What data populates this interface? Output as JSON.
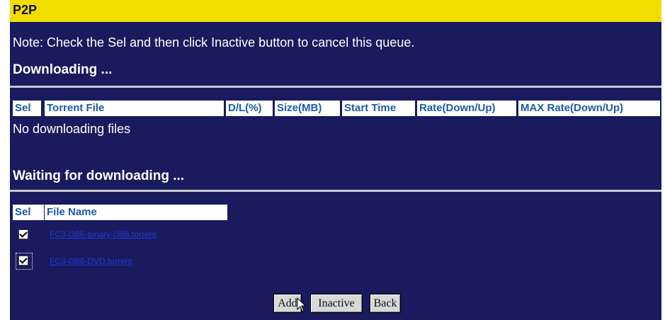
{
  "title": "P2P",
  "note": "Note: Check the Sel and then click Inactive button to cancel this queue.",
  "downloading": {
    "heading": "Downloading ...",
    "columns": [
      "Sel",
      "Torrent File",
      "D/L(%)",
      "Size(MB)",
      "Start Time",
      "Rate(Down/Up)",
      "MAX Rate(Down/Up)"
    ],
    "empty_message": "No downloading files"
  },
  "waiting": {
    "heading": "Waiting for downloading ...",
    "columns": [
      "Sel",
      "File Name"
    ],
    "rows": [
      {
        "checked": true,
        "file_name": "FC3-i386-binary-i386.torrent"
      },
      {
        "checked": true,
        "file_name": "FC3-i386-DVD.torrent"
      }
    ]
  },
  "buttons": {
    "add": "Add",
    "inactive": "Inactive",
    "back": "Back"
  },
  "colors": {
    "background": "#1a1a5e",
    "title_bar": "#f1de00",
    "header_text": "#1e5aa8",
    "link": "#1c3bd0"
  }
}
